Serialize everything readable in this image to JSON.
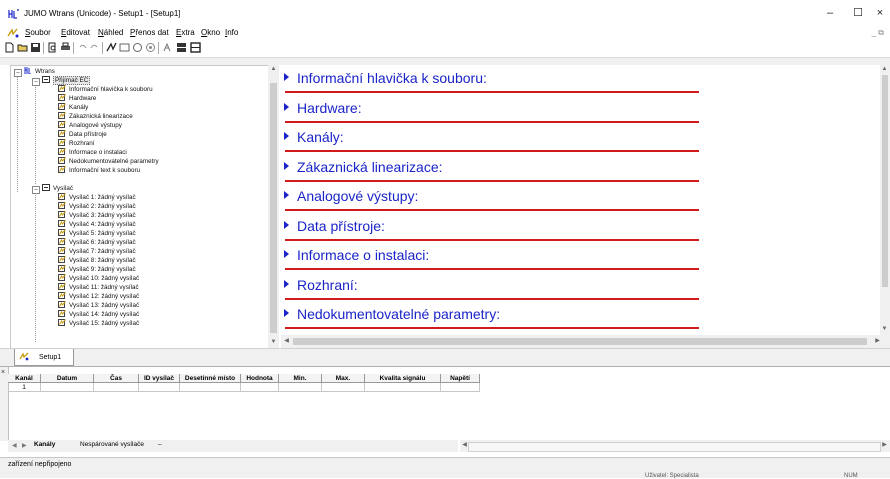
{
  "window": {
    "title": "JUMO Wtrans (Unicode) - Setup1 - [Setup1]",
    "controls": {
      "minimize": "–",
      "maximize": "☐",
      "close": "×"
    }
  },
  "menu": {
    "items": [
      {
        "label": "Soubor",
        "accel": "S",
        "rest": "oubor"
      },
      {
        "label": "Editovat",
        "accel": "E",
        "rest": "ditovat"
      },
      {
        "label": "Náhled",
        "accel": "N",
        "rest": "áhled"
      },
      {
        "label": "Přenos dat",
        "accel": "P",
        "rest": "řenos dat"
      },
      {
        "label": "Extra",
        "accel": "E",
        "rest": "xtra"
      },
      {
        "label": "Okno",
        "accel": "O",
        "rest": "kno"
      },
      {
        "label": "Info",
        "accel": "I",
        "rest": "nfo"
      }
    ],
    "mdi_controls": "_ ⧉"
  },
  "tree": {
    "root": "Wtrans",
    "receiver_group": "Přijímač EC",
    "receiver_items": [
      "Informační hlavička k souboru",
      "Hardware",
      "Kanály",
      "Zákaznická linearizace",
      "Analogové výstupy",
      "Data přístroje",
      "Rozhraní",
      "Informace o instalaci",
      "Nedokumentovatelné parametry",
      "Informační text k souboru"
    ],
    "transmitter_group": "Vysílač",
    "transmitter_items": [
      "Vysílač 1: žádný vysílač",
      "Vysílač 2: žádný vysílač",
      "Vysílač 3: žádný vysílač",
      "Vysílač 4: žádný vysílač",
      "Vysílač 5: žádný vysílač",
      "Vysílač 6: žádný vysílač",
      "Vysílač 7: žádný vysílač",
      "Vysílač 8: žádný vysílač",
      "Vysílač 9: žádný vysílač",
      "Vysílač 10: žádný vysílač",
      "Vysílač 11: žádný vysílač",
      "Vysílač 12: žádný vysílač",
      "Vysílač 13: žádný vysílač",
      "Vysílač 14: žádný vysílač",
      "Vysílač 15: žádný vysílač"
    ]
  },
  "content": {
    "sections": [
      "Informační hlavička k souboru:",
      "Hardware:",
      "Kanály:",
      "Zákaznická linearizace:",
      "Analogové výstupy:",
      "Data přístroje:",
      "Informace o instalaci:",
      "Rozhraní:",
      "Nedokumentovatelné parametry:"
    ]
  },
  "doc_tab": {
    "label": "Setup1"
  },
  "grid": {
    "close": "×",
    "columns": [
      "Kanál",
      "Datum",
      "Čas",
      "ID vysílač",
      "Desetinné místo",
      "Hodnota",
      "Min.",
      "Max.",
      "Kvalita signálu",
      "Napětí"
    ],
    "rows": [
      [
        "1",
        "",
        "",
        "",
        "",
        "",
        "",
        "",
        "",
        ""
      ]
    ]
  },
  "sheets": {
    "tabs": [
      "Kanály",
      "Nespárované vysílače",
      "–"
    ],
    "active": "Kanály"
  },
  "status": {
    "text": "zařízení nepřipojeno",
    "user": "Uživatel: Specialista",
    "num": "NUM"
  },
  "colors": {
    "section_title": "#1a24c8",
    "section_rule": "#d21a1a"
  }
}
